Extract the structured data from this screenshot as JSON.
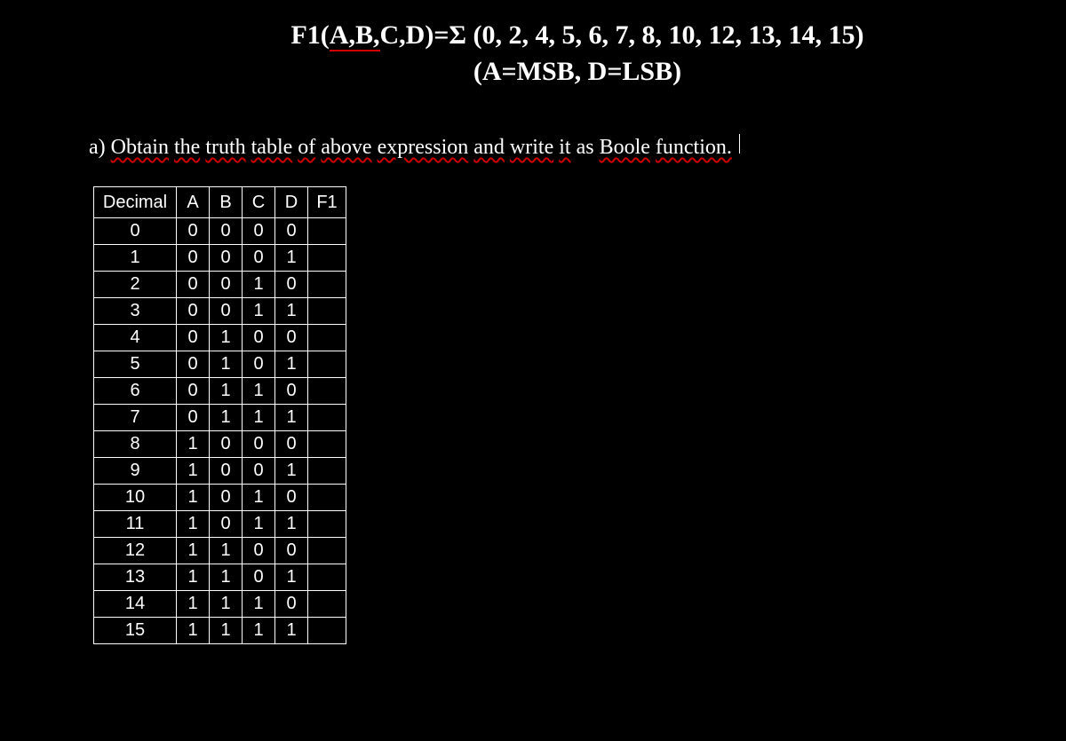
{
  "title": {
    "prefix": "F1(",
    "vars_underlined": "A,B,",
    "vars_rest": "C,D)=Σ (0, 2, 4, 5, 6, 7, 8, 10, 12, 13, 14, 15)",
    "line2": "(A=MSB, D=LSB)"
  },
  "question": {
    "label": "a)",
    "w1": "Obtain",
    "w2": "the",
    "w3": "truth",
    "w4": "table",
    "w5": "of",
    "w6": "above",
    "w7": "expression",
    "w8": "and",
    "w9": "write",
    "w10": "it",
    "plain": "as",
    "w11": "Boole",
    "w12": "function."
  },
  "table": {
    "headers": {
      "dec": "Decimal",
      "a": "A",
      "b": "B",
      "c": "C",
      "d": "D",
      "f1": "F1"
    },
    "rows": [
      {
        "dec": "0",
        "a": "0",
        "b": "0",
        "c": "0",
        "d": "0",
        "f1": ""
      },
      {
        "dec": "1",
        "a": "0",
        "b": "0",
        "c": "0",
        "d": "1",
        "f1": ""
      },
      {
        "dec": "2",
        "a": "0",
        "b": "0",
        "c": "1",
        "d": "0",
        "f1": ""
      },
      {
        "dec": "3",
        "a": "0",
        "b": "0",
        "c": "1",
        "d": "1",
        "f1": ""
      },
      {
        "dec": "4",
        "a": "0",
        "b": "1",
        "c": "0",
        "d": "0",
        "f1": ""
      },
      {
        "dec": "5",
        "a": "0",
        "b": "1",
        "c": "0",
        "d": "1",
        "f1": ""
      },
      {
        "dec": "6",
        "a": "0",
        "b": "1",
        "c": "1",
        "d": "0",
        "f1": ""
      },
      {
        "dec": "7",
        "a": "0",
        "b": "1",
        "c": "1",
        "d": "1",
        "f1": ""
      },
      {
        "dec": "8",
        "a": "1",
        "b": "0",
        "c": "0",
        "d": "0",
        "f1": ""
      },
      {
        "dec": "9",
        "a": "1",
        "b": "0",
        "c": "0",
        "d": "1",
        "f1": ""
      },
      {
        "dec": "10",
        "a": "1",
        "b": "0",
        "c": "1",
        "d": "0",
        "f1": ""
      },
      {
        "dec": "11",
        "a": "1",
        "b": "0",
        "c": "1",
        "d": "1",
        "f1": ""
      },
      {
        "dec": "12",
        "a": "1",
        "b": "1",
        "c": "0",
        "d": "0",
        "f1": ""
      },
      {
        "dec": "13",
        "a": "1",
        "b": "1",
        "c": "0",
        "d": "1",
        "f1": ""
      },
      {
        "dec": "14",
        "a": "1",
        "b": "1",
        "c": "1",
        "d": "0",
        "f1": ""
      },
      {
        "dec": "15",
        "a": "1",
        "b": "1",
        "c": "1",
        "d": "1",
        "f1": ""
      }
    ]
  }
}
